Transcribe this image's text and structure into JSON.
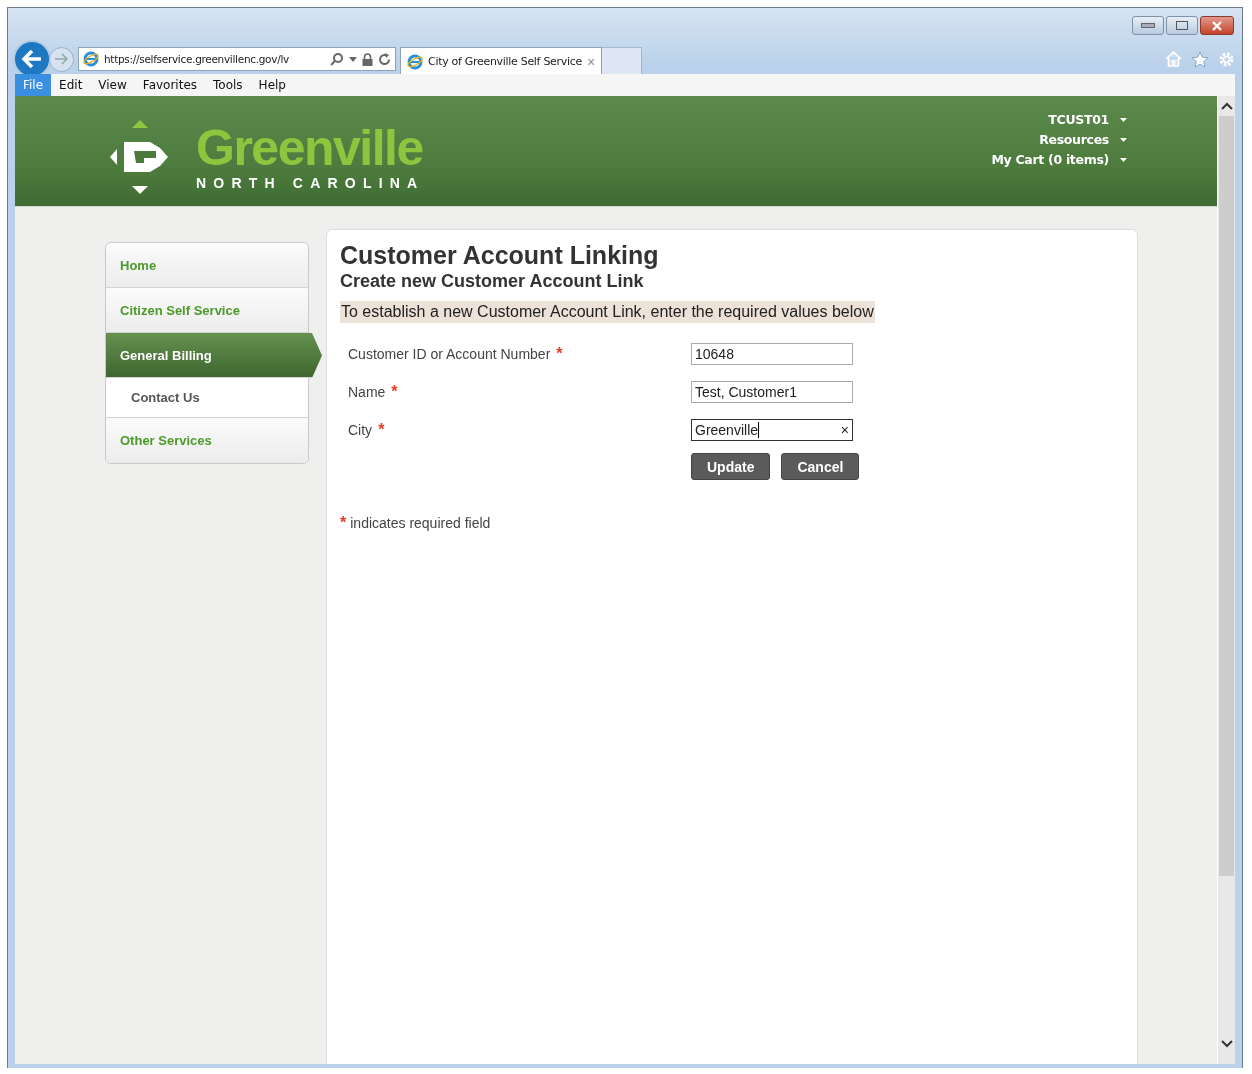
{
  "browser": {
    "address": "https://selfservice.greenvillenc.gov/lv",
    "tabs": [
      {
        "title": "City of Greenville Self Service",
        "close": "×",
        "selected": true
      }
    ],
    "menu": [
      {
        "label": "File",
        "selected": true
      },
      {
        "label": "Edit",
        "selected": false
      },
      {
        "label": "View",
        "selected": false
      },
      {
        "label": "Favorites",
        "selected": false
      },
      {
        "label": "Tools",
        "selected": false
      },
      {
        "label": "Help",
        "selected": false
      }
    ]
  },
  "header": {
    "logo": {
      "name": "Greenville",
      "subtitle": "NORTH CAROLINA"
    },
    "user_menu": [
      {
        "label": "TCUST01"
      },
      {
        "label": "Resources"
      },
      {
        "label": "My Cart (0 items)"
      }
    ]
  },
  "sidebar": {
    "items": [
      {
        "label": "Home",
        "selected": false
      },
      {
        "label": "Citizen Self Service",
        "selected": false
      },
      {
        "label": "General Billing",
        "selected": true,
        "children": [
          {
            "label": "Contact Us",
            "selected": false
          }
        ]
      },
      {
        "label": "Other Services",
        "selected": false
      }
    ]
  },
  "page": {
    "title": "Customer Account Linking",
    "subtitle": "Create new Customer Account Link",
    "instruction": "To establish a new Customer Account Link, enter the required values below",
    "fields": [
      {
        "label": "Customer ID or Account Number",
        "mark": "*",
        "value": "10648",
        "focused": false
      },
      {
        "label": "Name",
        "mark": "*",
        "value": "Test, Customer1",
        "focused": false
      },
      {
        "label": "City",
        "mark": "*",
        "value": "Greenville",
        "focused": true,
        "clear": "×"
      }
    ],
    "buttons": [
      "Update",
      "Cancel"
    ],
    "note": {
      "mark": "*",
      "text": "indicates required field"
    }
  }
}
